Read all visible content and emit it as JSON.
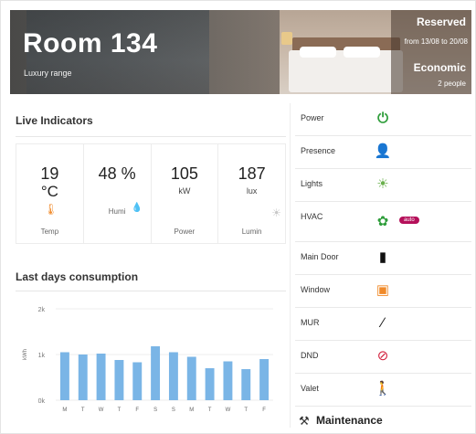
{
  "header": {
    "room_title": "Room 134",
    "room_subtitle": "Luxury range",
    "reservation_status": "Reserved",
    "reservation_dates": "from 13/08 to 20/08",
    "rate_range": "Economic",
    "guests": "2 people"
  },
  "live": {
    "title": "Live Indicators",
    "tiles": [
      {
        "value": "19",
        "unit": "°C",
        "label": "Temp",
        "icon": "thermometer-icon",
        "icon_color": "#f08a2a"
      },
      {
        "value": "48 %",
        "unit": "",
        "label": "Humi",
        "icon": "droplet-icon",
        "icon_color": "#3aa0e0"
      },
      {
        "value": "105",
        "unit": "kW",
        "label": "Power",
        "icon": "",
        "icon_color": ""
      },
      {
        "value": "187",
        "unit": "lux",
        "label": "Lumin",
        "icon": "sun-icon",
        "icon_color": "#c8c8c8"
      }
    ]
  },
  "consumption": {
    "title": "Last days consumption"
  },
  "chart_data": {
    "type": "bar",
    "categories": [
      "M",
      "T",
      "W",
      "T",
      "F",
      "S",
      "S",
      "M",
      "T",
      "W",
      "T",
      "F"
    ],
    "values": [
      1.05,
      1.0,
      1.02,
      0.88,
      0.83,
      1.18,
      1.05,
      0.95,
      0.7,
      0.85,
      0.68,
      0.9
    ],
    "ylabel": "kWh",
    "yticks": [
      "0k",
      "1k",
      "2k"
    ],
    "ylim": [
      0,
      2
    ],
    "color": "#7ab5e6"
  },
  "status": {
    "rows": [
      {
        "label": "Power",
        "icon": "power-icon",
        "color": "#2e9d3a"
      },
      {
        "label": "Presence",
        "icon": "person-icon",
        "color": "#2e9d3a"
      },
      {
        "label": "Lights",
        "icon": "bulb-icon",
        "color": "#6ab04c"
      },
      {
        "label": "HVAC",
        "icon": "fan-icon",
        "color": "#2e9d3a",
        "badge": "auto"
      },
      {
        "label": "Main Door",
        "icon": "door-icon",
        "color": "#111111"
      },
      {
        "label": "Window",
        "icon": "window-icon",
        "color": "#f08a2a"
      },
      {
        "label": "MUR",
        "icon": "broom-icon",
        "color": "#111111"
      },
      {
        "label": "DND",
        "icon": "no-entry-icon",
        "color": "#d21f3c"
      },
      {
        "label": "Valet",
        "icon": "valet-icon",
        "color": "#111111"
      }
    ],
    "maintenance_label": "Maintenance"
  }
}
